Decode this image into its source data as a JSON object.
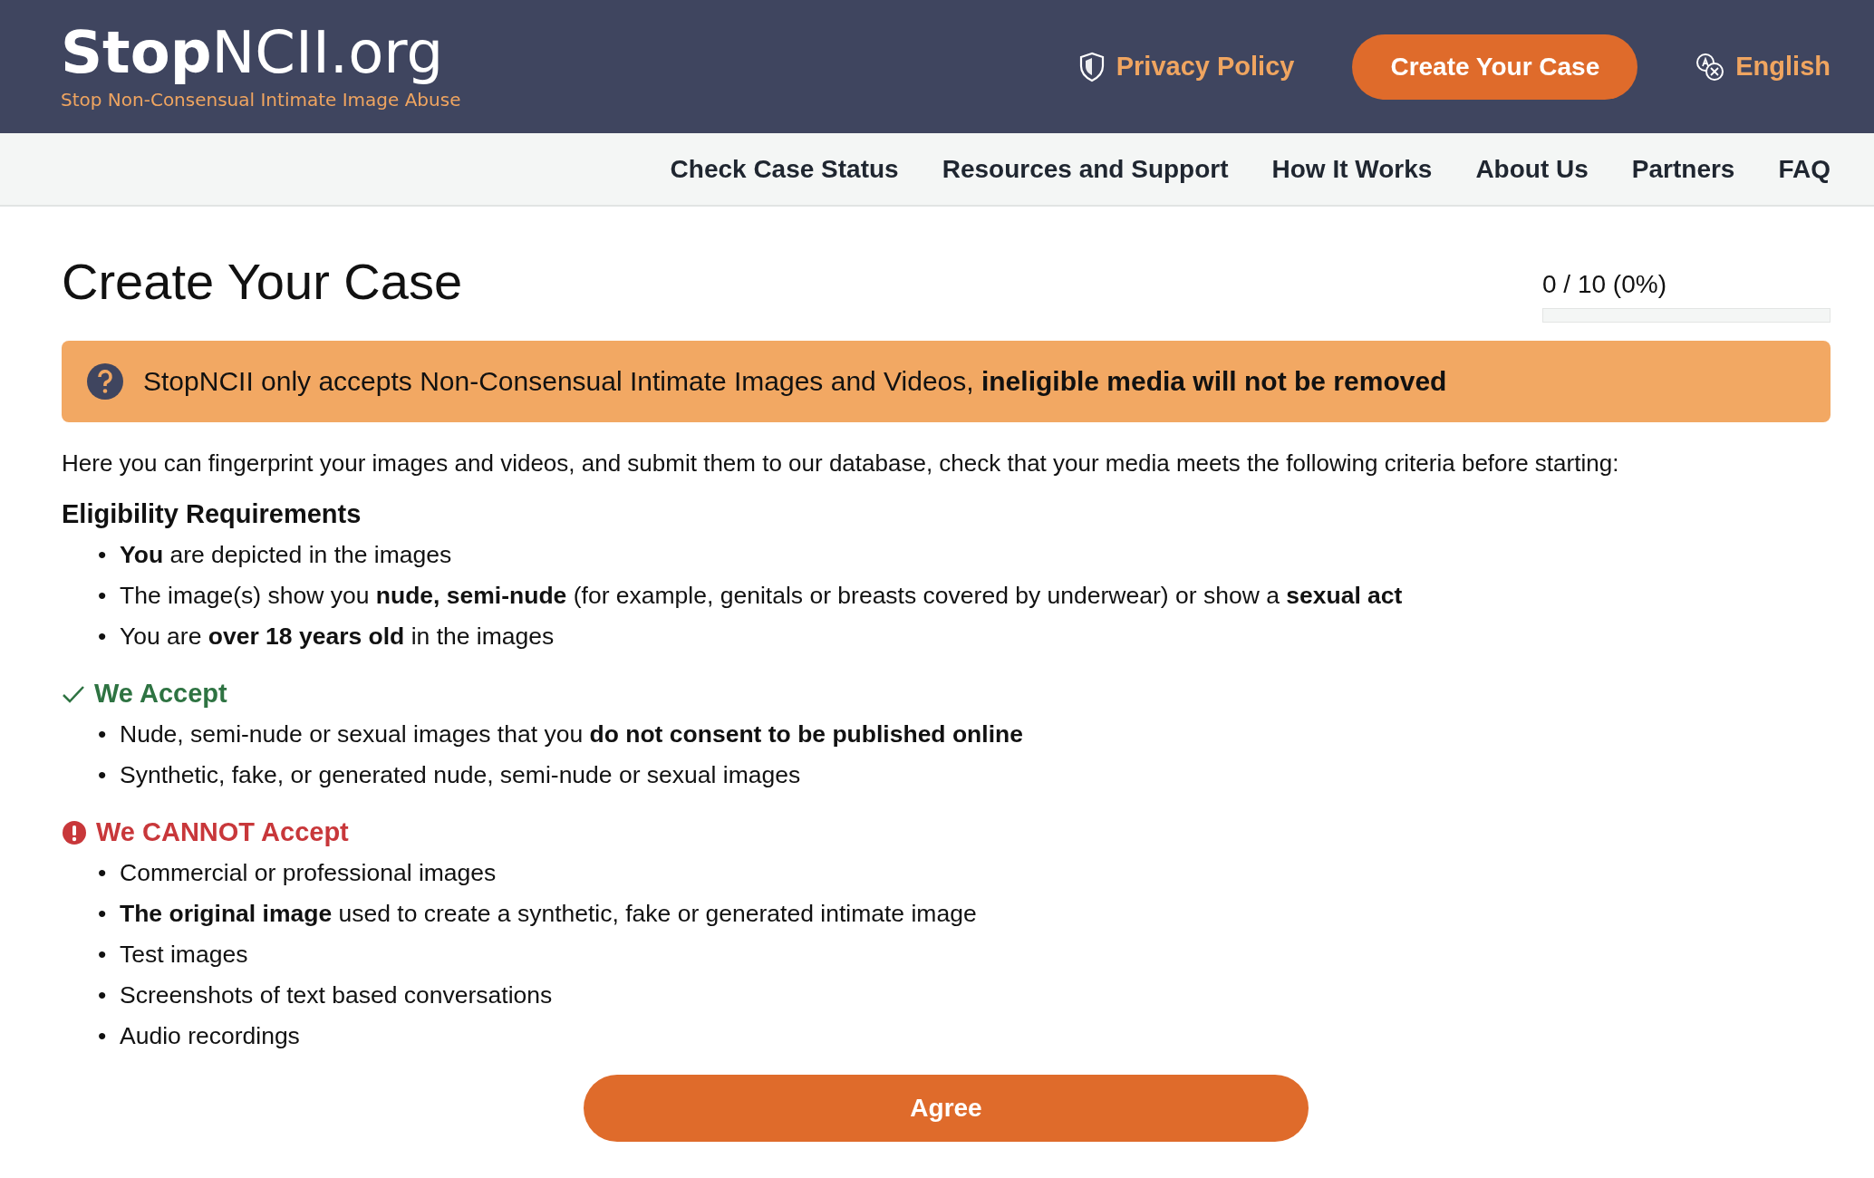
{
  "header": {
    "logo": "**Stop**NCII.org",
    "tagline": "Stop Non-Consensual Intimate Image Abuse",
    "privacy_link": "Privacy Policy",
    "create_button": "Create Your Case",
    "language": "English"
  },
  "nav": [
    "Check Case Status",
    "Resources and Support",
    "How It Works",
    "About Us",
    "Partners",
    "FAQ"
  ],
  "page": {
    "title": "Create Your Case",
    "progress": {
      "text": "0 / 10 (0%)",
      "level": 0
    }
  },
  "notice": "StopNCII only accepts Non-Consensual Intimate Images and Videos, **ineligible media will not be removed**",
  "intro": "Here you can fingerprint your images and videos, and submit them to our database, check that your media meets the following criteria before starting:",
  "sections": [
    {
      "kind": "plain",
      "bullet": "•",
      "heading": "Eligibility Requirements",
      "items": [
        "**You** are depicted in the images",
        "The image(s) show you **nude, semi-nude** (for example, genitals or breasts covered by underwear) or show a **sexual act**",
        "You are **over 18 years old** in the images"
      ]
    },
    {
      "kind": "accept",
      "bullet": "•",
      "heading": "We Accept",
      "items": [
        "Nude, semi-nude or sexual images that you **do not consent to be published online**",
        "Synthetic, fake, or generated nude, semi-nude or sexual images"
      ]
    },
    {
      "kind": "reject",
      "bullet": "•",
      "heading": "We CANNOT Accept",
      "items": [
        "Commercial or professional images",
        "**The original image** used to create a synthetic, fake or generated intimate image",
        "Test images",
        "Screenshots of text based conversations",
        "Audio recordings"
      ]
    }
  ],
  "agree_button": "Agree"
}
